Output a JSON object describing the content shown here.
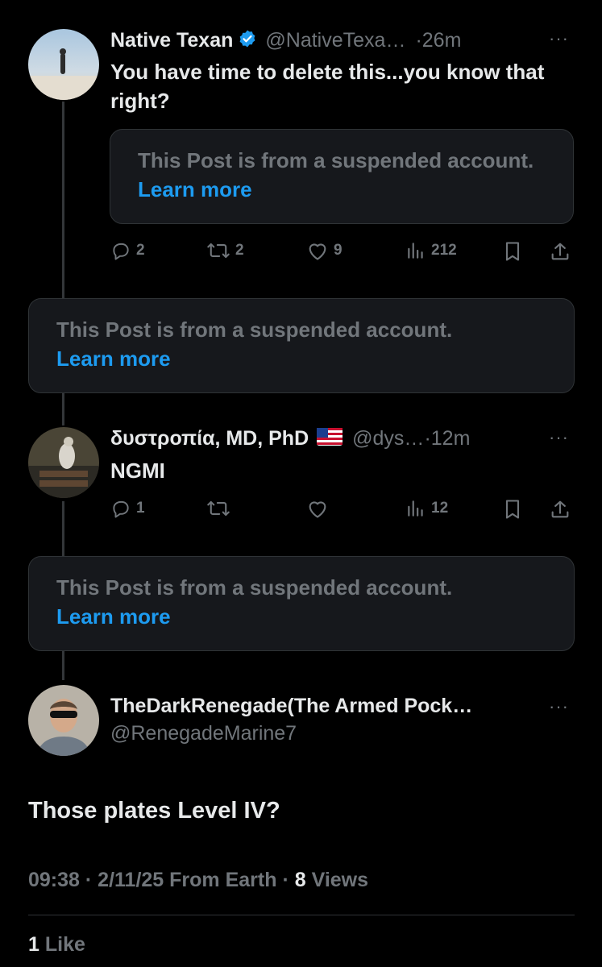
{
  "thread": [
    {
      "author_name": "Native Texan",
      "verified": true,
      "handle": "@NativeTexa…",
      "time": "·26m",
      "more_label": "···",
      "text": "You have time to delete this...you know that right?",
      "quoted_notice": "This Post is from a suspended account.",
      "quoted_link": "Learn more",
      "stats": {
        "replies": "2",
        "reposts": "2",
        "likes": "9",
        "views": "212"
      }
    },
    {
      "suspended_notice": "This Post is from a suspended account.",
      "link": "Learn more"
    },
    {
      "author_name": "δυστροπία, MD, PhD",
      "flag": "🇺🇸",
      "handle": "@dys…",
      "time": "·12m",
      "more_label": "···",
      "text": "NGMI",
      "stats": {
        "replies": "1",
        "reposts": "",
        "likes": "",
        "views": "12"
      }
    },
    {
      "suspended_notice": "This Post is from a suspended account.",
      "link": "Learn more"
    }
  ],
  "main_post": {
    "author_name": "TheDarkRenegade(The Armed Pock…",
    "handle": "@RenegadeMarine7",
    "more_label": "···",
    "text": "Those plates Level IV?",
    "time": "09:38",
    "date": "2/11/25",
    "source": "From Earth",
    "views_count": "8",
    "views_label": "Views",
    "likes_count": "1",
    "likes_label": "Like"
  },
  "colors": {
    "background": "#000000",
    "text": "#e7e9ea",
    "muted": "#71767b",
    "link": "#1d9bf0",
    "verified": "#1d9bf0"
  }
}
